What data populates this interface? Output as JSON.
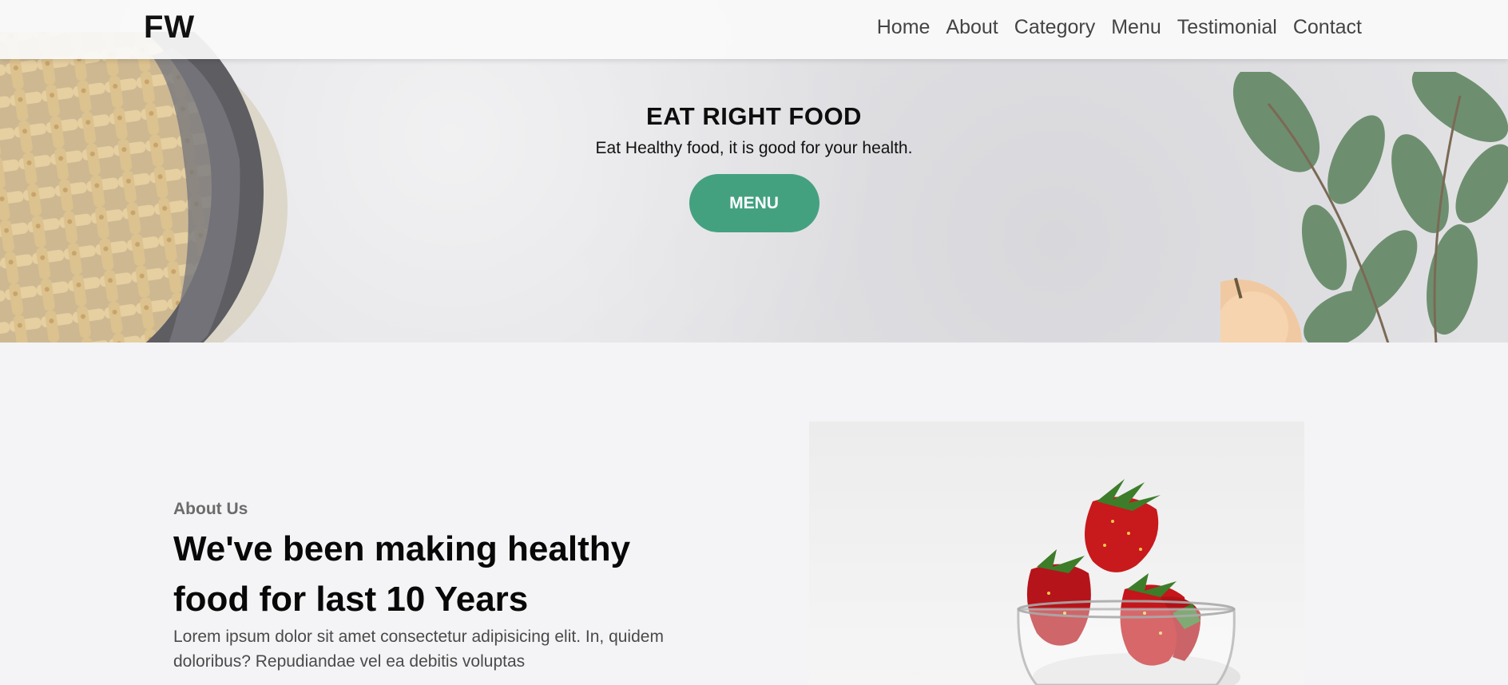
{
  "nav": {
    "logo": "FW",
    "links": [
      "Home",
      "About",
      "Category",
      "Menu",
      "Testimonial",
      "Contact"
    ]
  },
  "hero": {
    "title": "EAT RIGHT FOOD",
    "subtitle": "Eat Healthy food, it is good for your health.",
    "button_label": "MENU",
    "accent_color": "#44a180"
  },
  "about": {
    "label": "About Us",
    "heading": "We've been making healthy food for last 10 Years",
    "text": "Lorem ipsum dolor sit amet consectetur adipisicing elit. In, quidem doloribus? Repudiandae vel ea debitis voluptas"
  }
}
